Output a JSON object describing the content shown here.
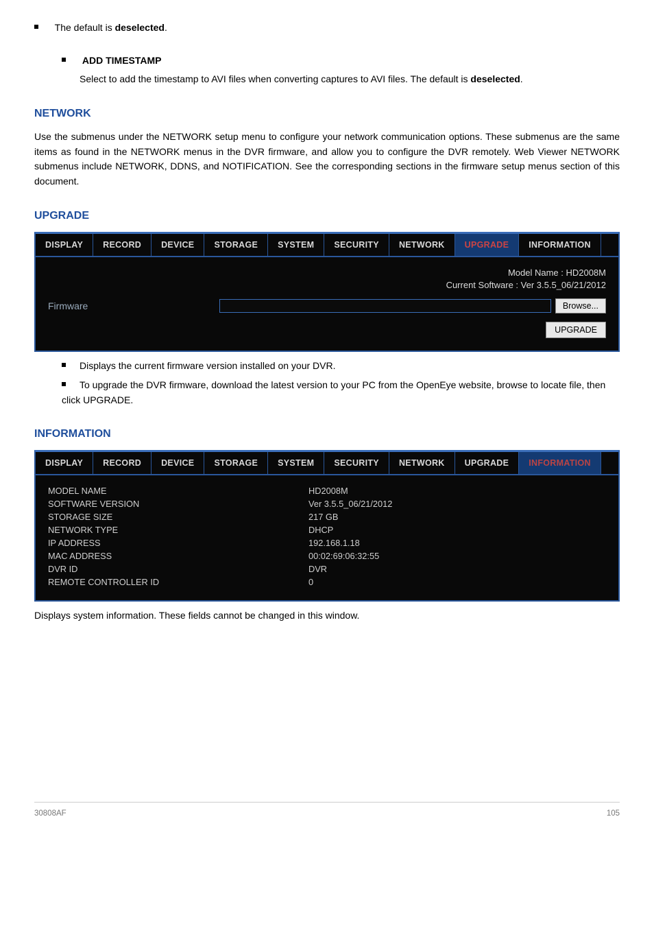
{
  "paragraphs": {
    "p1a": "The default is ",
    "p1b": "deselected",
    "p1c": ".",
    "p2_label": "ADD TIMESTAMP",
    "p2a": "Select to add the timestamp to AVI files when converting captures to AVI files. The default is ",
    "p2b": "deselected",
    "p2c": "."
  },
  "h_network": "NETWORK",
  "network_intro": "Use the submenus under the NETWORK setup menu to configure your network communication options. These submenus are the same items as found in the NETWORK menus in the DVR firmware, and allow you to configure the DVR remotely. Web Viewer NETWORK submenus include NETWORK, DDNS, and NOTIFICATION. See the corresponding sections in the firmware setup menus section of this document.",
  "h_upgrade": "UPGRADE",
  "panel1": {
    "tabs": [
      "DISPLAY",
      "RECORD",
      "DEVICE",
      "STORAGE",
      "SYSTEM",
      "SECURITY",
      "NETWORK",
      "UPGRADE",
      "INFORMATION"
    ],
    "active": "UPGRADE",
    "model_line": "Model Name : HD2008M",
    "sw_line": "Current Software : Ver 3.5.5_06/21/2012",
    "firmware_label": "Firmware",
    "browse": "Browse...",
    "upgrade_btn": "UPGRADE"
  },
  "bul1": "Displays the current firmware version installed on your DVR.",
  "bul2": "To upgrade the DVR firmware, download the latest version to your PC from the OpenEye website, browse to locate file, then click UPGRADE.",
  "h_information": "INFORMATION",
  "panel2": {
    "tabs": [
      "DISPLAY",
      "RECORD",
      "DEVICE",
      "STORAGE",
      "SYSTEM",
      "SECURITY",
      "NETWORK",
      "UPGRADE",
      "INFORMATION"
    ],
    "active": "INFORMATION",
    "rows": [
      {
        "k": "MODEL NAME",
        "v": "HD2008M"
      },
      {
        "k": "SOFTWARE VERSION",
        "v": "Ver 3.5.5_06/21/2012"
      },
      {
        "k": "STORAGE SIZE",
        "v": "217 GB"
      },
      {
        "k": "NETWORK TYPE",
        "v": "DHCP"
      },
      {
        "k": "IP ADDRESS",
        "v": "192.168.1.18"
      },
      {
        "k": "MAC ADDRESS",
        "v": "00:02:69:06:32:55"
      },
      {
        "k": "DVR ID",
        "v": "DVR"
      },
      {
        "k": "REMOTE CONTROLLER ID",
        "v": "0"
      }
    ]
  },
  "info_text": "Displays system information. These fields cannot be changed in this window.",
  "footer_left": "30808AF",
  "footer_right": "105"
}
